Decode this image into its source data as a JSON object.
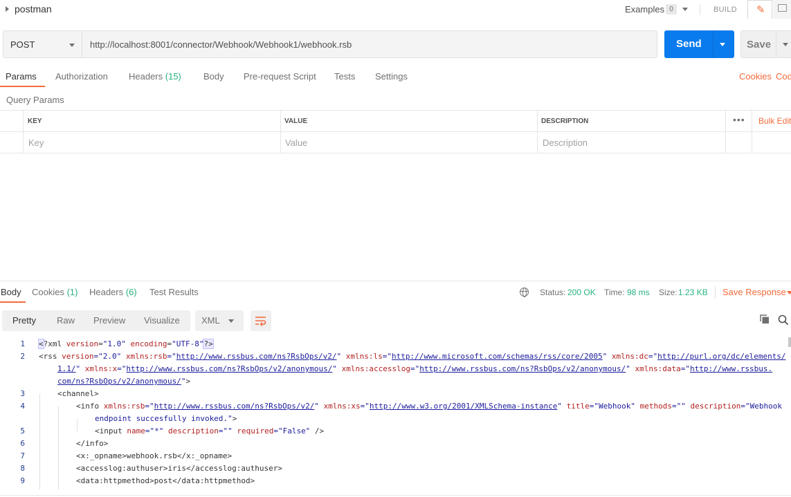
{
  "collection": {
    "name": "postman"
  },
  "header": {
    "examples_label": "Examples",
    "examples_count": "0",
    "build_label": "BUILD"
  },
  "request": {
    "method": "POST",
    "url": "http://localhost:8001/connector/Webhook/Webhook1/webhook.rsb",
    "send_label": "Send",
    "save_label": "Save"
  },
  "request_tabs": {
    "params": "Params",
    "authorization": "Authorization",
    "headers": "Headers",
    "headers_count": "(15)",
    "body": "Body",
    "prerequest": "Pre-request Script",
    "tests": "Tests",
    "settings": "Settings",
    "cookies": "Cookies",
    "code": "Cod"
  },
  "query_params": {
    "title": "Query Params",
    "col_key": "KEY",
    "col_value": "VALUE",
    "col_description": "DESCRIPTION",
    "ph_key": "Key",
    "ph_value": "Value",
    "ph_description": "Description",
    "more": "•••",
    "bulk_edit": "Bulk Edit"
  },
  "response_tabs": {
    "body": "Body",
    "cookies": "Cookies",
    "cookies_count": "(1)",
    "headers": "Headers",
    "headers_count": "(6)",
    "test_results": "Test Results"
  },
  "response_status": {
    "status_label": "Status:",
    "status_value": "200 OK",
    "time_label": "Time:",
    "time_value": "98 ms",
    "size_label": "Size:",
    "size_value": "1.23 KB",
    "save_response": "Save Response"
  },
  "format": {
    "pretty": "Pretty",
    "raw": "Raw",
    "preview": "Preview",
    "visualize": "Visualize",
    "language": "XML"
  },
  "code": {
    "line_numbers": [
      "1",
      "2",
      "3",
      "4",
      "5",
      "6",
      "7",
      "8",
      "9"
    ],
    "l1": {
      "open": "<",
      "decl": "?xml ",
      "a1": "version",
      "eq1": "=",
      "v1": "\"1.0\"",
      "a2": " encoding",
      "eq2": "=",
      "v2": "\"UTF-8\"",
      "close": "?>"
    },
    "l2a": {
      "tag": "<rss ",
      "a1": "version",
      "v1": "=\"2.0\"",
      "a2": " xmlns:rsb",
      "q2o": "=\"",
      "u2": "http://www.rssbus.com/ns?RsbOps/v2/",
      "q2c": "\"",
      "a3": " xmlns:ls",
      "q3o": "=\"",
      "u3": "http://www.microsoft.com/schemas/rss/core/2005",
      "q3c": "\"",
      "a4": " xmlns:dc",
      "q4o": "=\"",
      "u4": "http://purl.org/dc/elements/"
    },
    "l2b": {
      "u4b": "1.1/",
      "q4c": "\"",
      "a5": " xmlns:x",
      "q5o": "=\"",
      "u5": "http://www.rssbus.com/ns?RsbOps/v2/anonymous/",
      "q5c": "\"",
      "a6": "  xmlns:accesslog",
      "q6o": "=\"",
      "u6": "http://www.rssbus.com/ns?RsbOps/v2/anonymous/",
      "q6c": "\"",
      "a7": " xmlns:data",
      "q7o": "=\"",
      "u7": "http://www.rssbus."
    },
    "l2c": {
      "u7b": "com/ns?RsbOps/v2/anonymous/",
      "q7c": "\"",
      "end": ">"
    },
    "l3": "<channel>",
    "l4a": {
      "tag": "<info ",
      "a1": "xmlns:rsb",
      "q1o": "=\"",
      "u1": "http://www.rssbus.com/ns?RsbOps/v2/",
      "q1c": "\"",
      "a2": " xmlns:xs",
      "q2o": "=\"",
      "u2": "http://www.w3.org/2001/XMLSchema-instance",
      "q2c": "\"",
      "a3": " title",
      "v3": "=\"Webhook\"",
      "a4": " methods",
      "v4": "=\"\"",
      "a5": " description",
      "v5": "=\"Webhook"
    },
    "l4b": {
      "v5b": "endpoint succesfully invoked.\"",
      "end": ">"
    },
    "l5": {
      "tag": "<input ",
      "a1": "name",
      "v1": "=\"*\"",
      "a2": " description",
      "v2": "=\"\"",
      "a3": " required",
      "v3": "=\"False\"",
      "end": " />"
    },
    "l6": "</info>",
    "l7": "<x:_opname>webhook.rsb</x:_opname>",
    "l8": "<accesslog:authuser>iris</accesslog:authuser>",
    "l9": "<data:httpmethod>post</data:httpmethod>"
  }
}
